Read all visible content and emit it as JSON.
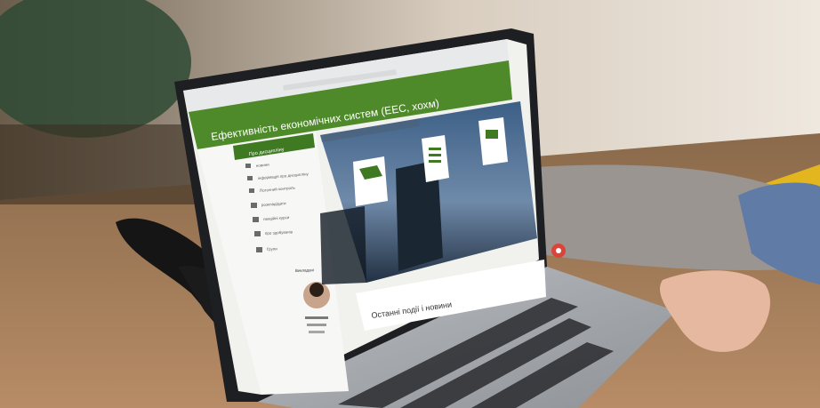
{
  "course": {
    "title": "Ефективність економічних систем (ЕЕС, хохм)"
  },
  "sidebar": {
    "items": [
      {
        "label": "Про дисципліну",
        "icon": "book-icon"
      },
      {
        "label": "новини",
        "icon": "news-icon"
      },
      {
        "label": "інформація про дисципліну",
        "icon": "info-icon"
      },
      {
        "label": "Поточний контроль",
        "icon": "check-icon"
      },
      {
        "label": "розклад/дати",
        "icon": "calendar-icon"
      },
      {
        "label": "лекційні курси",
        "icon": "lecture-icon"
      },
      {
        "label": "про здобувачів",
        "icon": "people-icon"
      },
      {
        "label": "Групи",
        "icon": "group-icon"
      }
    ],
    "teacher_heading": "Викладачі"
  },
  "main": {
    "section_title": "Останні події і новини"
  },
  "colors": {
    "accent": "#4f8a2a",
    "accent_dark": "#3c6e1f",
    "sidebar_active": "#3f7a23",
    "fab": "#d9453a"
  }
}
